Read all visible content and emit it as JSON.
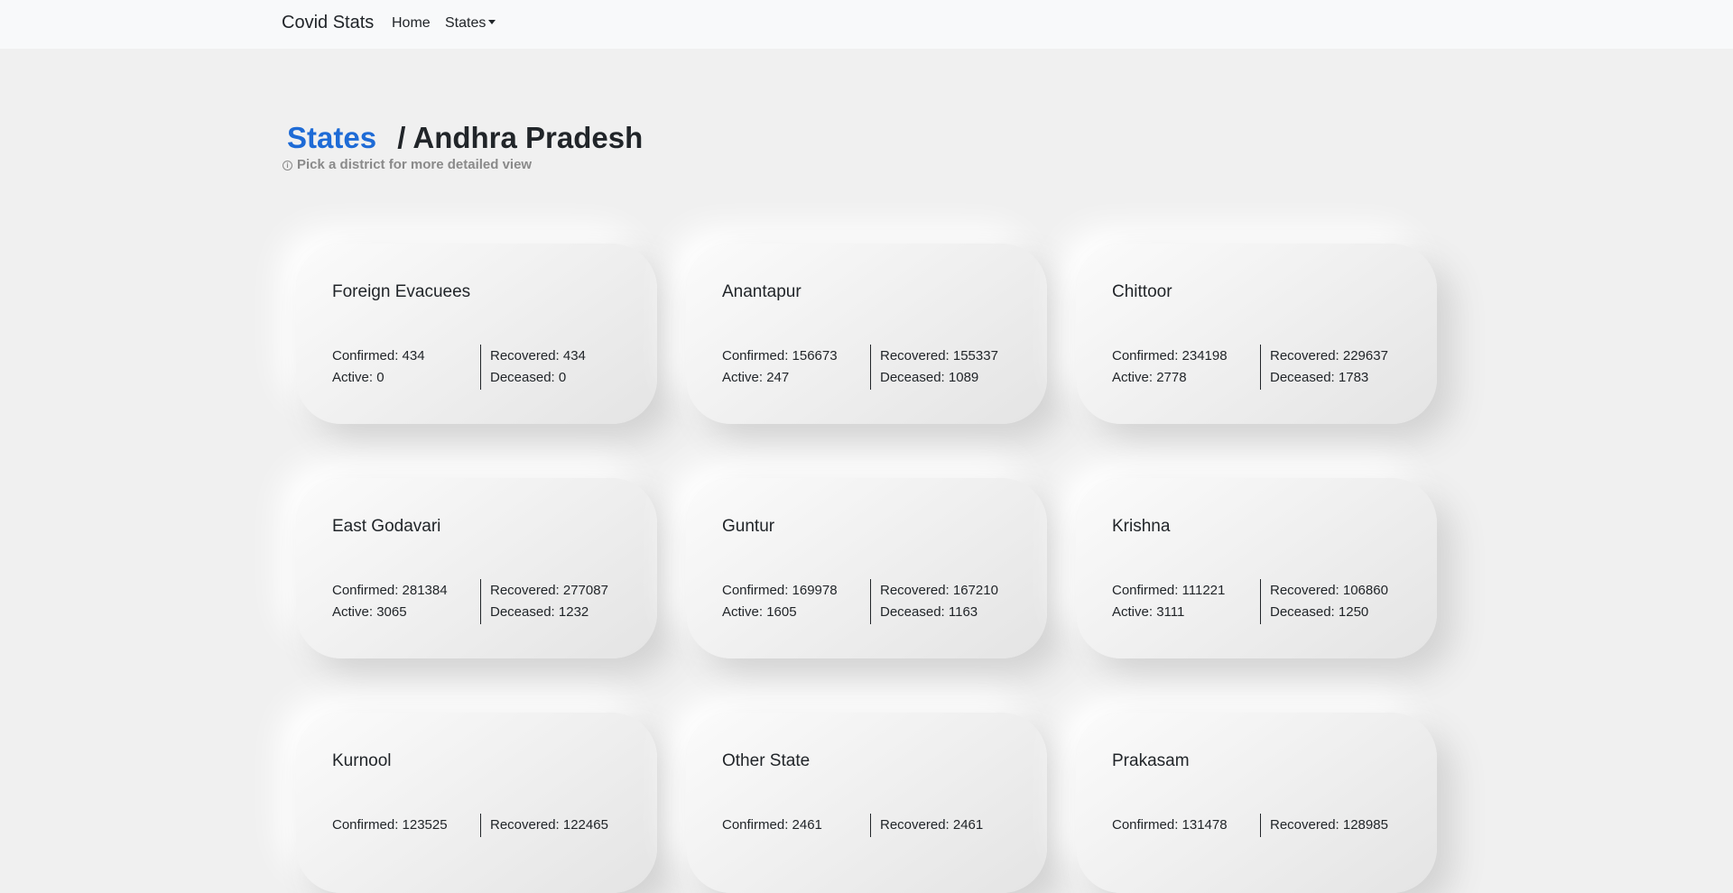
{
  "navbar": {
    "brand": "Covid Stats",
    "home": "Home",
    "states": "States"
  },
  "header": {
    "breadcrumb_link": "States",
    "separator": "/",
    "title": "Andhra Pradesh",
    "hint": "Pick a district for more detailed view",
    "hint_icon": "info-icon"
  },
  "labels": {
    "confirmed": "Confirmed: ",
    "active": "Active: ",
    "recovered": "Recovered: ",
    "deceased": "Deceased: "
  },
  "districts": [
    {
      "name": "Foreign Evacuees",
      "confirmed": "434",
      "active": "0",
      "recovered": "434",
      "deceased": "0"
    },
    {
      "name": "Anantapur",
      "confirmed": "156673",
      "active": "247",
      "recovered": "155337",
      "deceased": "1089"
    },
    {
      "name": "Chittoor",
      "confirmed": "234198",
      "active": "2778",
      "recovered": "229637",
      "deceased": "1783"
    },
    {
      "name": "East Godavari",
      "confirmed": "281384",
      "active": "3065",
      "recovered": "277087",
      "deceased": "1232"
    },
    {
      "name": "Guntur",
      "confirmed": "169978",
      "active": "1605",
      "recovered": "167210",
      "deceased": "1163"
    },
    {
      "name": "Krishna",
      "confirmed": "111221",
      "active": "3111",
      "recovered": "106860",
      "deceased": "1250"
    },
    {
      "name": "Kurnool",
      "confirmed": "123525",
      "active": "",
      "recovered": "122465",
      "deceased": ""
    },
    {
      "name": "Other State",
      "confirmed": "2461",
      "active": "",
      "recovered": "2461",
      "deceased": ""
    },
    {
      "name": "Prakasam",
      "confirmed": "131478",
      "active": "",
      "recovered": "128985",
      "deceased": ""
    }
  ],
  "colors": {
    "background": "#f0f0f0",
    "navbar": "#f8f9fa",
    "link": "#1e6bd6",
    "hint": "#8a8a8a"
  }
}
